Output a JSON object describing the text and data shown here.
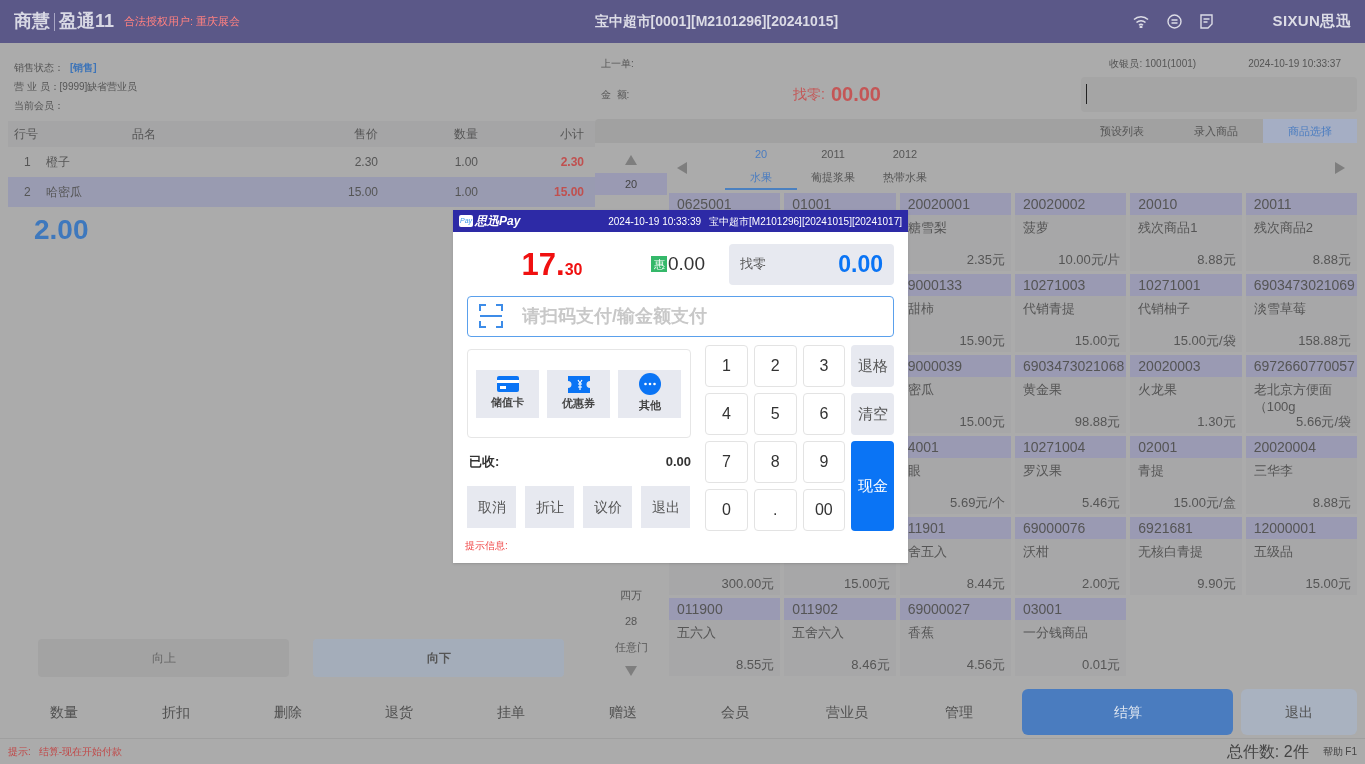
{
  "header": {
    "brand": "商慧",
    "product": "盈通11",
    "license": "合法授权用户: 重庆展会",
    "title": "宝中超市[0001][M2101296][20241015]",
    "logo": "SIXUN思迅"
  },
  "sale_info": [
    {
      "label": "销售状态：",
      "value": "[销售]"
    },
    {
      "label": "营 业 员：[9999]缺省营业员"
    },
    {
      "label": "当前会员："
    }
  ],
  "order_table": {
    "columns": [
      "行号",
      "品名",
      "售价",
      "数量",
      "小计"
    ],
    "rows": [
      {
        "no": "1",
        "name": "橙子",
        "price": "2.30",
        "qty": "1.00",
        "subtotal": "2.30",
        "selected": false
      },
      {
        "no": "2",
        "name": "哈密瓜",
        "price": "15.00",
        "qty": "1.00",
        "subtotal": "15.00",
        "selected": true
      }
    ]
  },
  "current_qty": "2.00",
  "list_nav": [
    {
      "label": "向上",
      "disabled": true
    },
    {
      "label": "向下",
      "disabled": false
    }
  ],
  "last_order_label": "上一单:",
  "cashier": "收银员: 1001(1001)",
  "datetime": "2024-10-19 10:33:37",
  "amount_label": "金  额:",
  "change_label": "找零:",
  "change_value": "00.00",
  "view_tabs": [
    {
      "label": "预设列表",
      "selected": false
    },
    {
      "label": "录入商品",
      "selected": false
    },
    {
      "label": "商品选择",
      "selected": true
    }
  ],
  "categories": [
    {
      "code": "20",
      "name": "水果",
      "selected": true
    },
    {
      "code": "2011",
      "name": "葡提浆果",
      "selected": false
    },
    {
      "code": "2012",
      "name": "热带水果",
      "selected": false
    }
  ],
  "group_list": {
    "top": [
      {
        "label": "20",
        "selected": true
      }
    ],
    "bottom": [
      {
        "label": "四万",
        "selected": false
      },
      {
        "label": "28",
        "selected": false
      },
      {
        "label": "任意门",
        "selected": false
      }
    ]
  },
  "products": [
    [
      {
        "code": "0625001"
      },
      {
        "code": "01001"
      },
      {
        "code": "20020001",
        "name": "糖雪梨",
        "price": "2.35元"
      },
      {
        "code": "20020002",
        "name": "菠萝",
        "price": "10.00元/片"
      },
      {
        "code": "20010",
        "name": "残次商品1",
        "price": "8.88元"
      },
      {
        "code": "20011",
        "name": "残次商品2",
        "price": "8.88元"
      }
    ],
    {
      "aligned_end": true,
      "cells": [
        {
          "code": "9000133",
          "name": "甜柿",
          "price": "15.90元"
        },
        {
          "code": "10271003",
          "name": "代销青提",
          "price": "15.00元"
        },
        {
          "code": "10271001",
          "name": "代销柚子",
          "price": "15.00元/袋"
        },
        {
          "code": "6903473021069",
          "name": "淡雪草莓",
          "price": "158.88元"
        }
      ]
    },
    {
      "aligned_end": true,
      "cells": [
        {
          "code": "9000039",
          "name": "密瓜",
          "price": "15.00元"
        },
        {
          "code": "6903473021068",
          "name": "黄金果",
          "price": "98.88元"
        },
        {
          "code": "20020003",
          "name": "火龙果",
          "price": "1.30元"
        },
        {
          "code": "6972660770057",
          "name": "老北京方便面（100g",
          "price": "5.66元/袋"
        }
      ]
    },
    {
      "aligned_end": true,
      "cells": [
        {
          "code": "4001",
          "name": "眼",
          "price": "5.69元/个"
        },
        {
          "code": "10271004",
          "name": "罗汉果",
          "price": "5.46元"
        },
        {
          "code": "02001",
          "name": "青提",
          "price": "15.00元/盒"
        },
        {
          "code": "20020004",
          "name": "三华李",
          "price": "8.88元"
        }
      ]
    },
    [
      {
        "price": "300.00元"
      },
      {
        "price": "15.00元"
      },
      {
        "code": "11901",
        "name": "舍五入",
        "price": "8.44元"
      },
      {
        "code": "69000076",
        "name": "沃柑",
        "price": "2.00元"
      },
      {
        "code": "6921681",
        "name": "无核白青提",
        "price": "9.90元"
      },
      {
        "code": "12000001",
        "name": "五级品",
        "price": "15.00元"
      }
    ],
    [
      {
        "code": "011900",
        "name": "五六入",
        "price": "8.55元"
      },
      {
        "code": "011902",
        "name": "五舍六入",
        "price": "8.46元"
      },
      {
        "code": "69000027",
        "name": "香蕉",
        "price": "4.56元"
      },
      {
        "code": "03001",
        "name": "一分钱商品",
        "price": "0.01元"
      }
    ]
  ],
  "toolbar": [
    {
      "label": "数量",
      "kind": "plain"
    },
    {
      "label": "折扣",
      "kind": "plain"
    },
    {
      "label": "删除",
      "kind": "plain"
    },
    {
      "label": "退货",
      "kind": "plain"
    },
    {
      "label": "挂单",
      "kind": "plain"
    },
    {
      "label": "赠送",
      "kind": "plain"
    },
    {
      "label": "会员",
      "kind": "plain"
    },
    {
      "label": "营业员",
      "kind": "plain"
    },
    {
      "label": "管理",
      "kind": "plain"
    },
    {
      "label": "结算",
      "kind": "primary"
    },
    {
      "label": "退出",
      "kind": "secondary"
    }
  ],
  "status_bar": {
    "hint_label": "提示:",
    "hint": "结算-现在开始付款",
    "total": "总件数: 2件",
    "help": "帮助 F1"
  },
  "pay_dialog": {
    "badge": "Pay",
    "brand": "思迅Pay",
    "datetime": "2024-10-19 10:33:39",
    "store": "宝中超市[M2101296][20241015][20241017]",
    "amount_int": "17.",
    "amount_dec": "30",
    "discount_badge": "惠",
    "discount": "0.00",
    "change_label": "找零",
    "change": "0.00",
    "placeholder": "请扫码支付/输金额支付",
    "methods": [
      {
        "label": "储值卡",
        "kind": "card"
      },
      {
        "label": "优惠券",
        "kind": "coupon"
      },
      {
        "label": "其他",
        "kind": "more"
      }
    ],
    "received_label": "已收:",
    "received": "0.00",
    "actions": [
      "取消",
      "折让",
      "议价",
      "退出"
    ],
    "keys": [
      {
        "label": "1",
        "kind": "digit"
      },
      {
        "label": "2",
        "kind": "digit"
      },
      {
        "label": "3",
        "kind": "digit"
      },
      {
        "label": "退格",
        "kind": "func"
      },
      {
        "label": "4",
        "kind": "digit"
      },
      {
        "label": "5",
        "kind": "digit"
      },
      {
        "label": "6",
        "kind": "digit"
      },
      {
        "label": "清空",
        "kind": "func"
      },
      {
        "label": "7",
        "kind": "digit"
      },
      {
        "label": "8",
        "kind": "digit"
      },
      {
        "label": "9",
        "kind": "digit"
      },
      {
        "label": "现金",
        "kind": "cash"
      },
      {
        "label": "0",
        "kind": "digit"
      },
      {
        "label": ".",
        "kind": "digit"
      },
      {
        "label": "00",
        "kind": "digit"
      }
    ],
    "hint": "提示信息:"
  }
}
